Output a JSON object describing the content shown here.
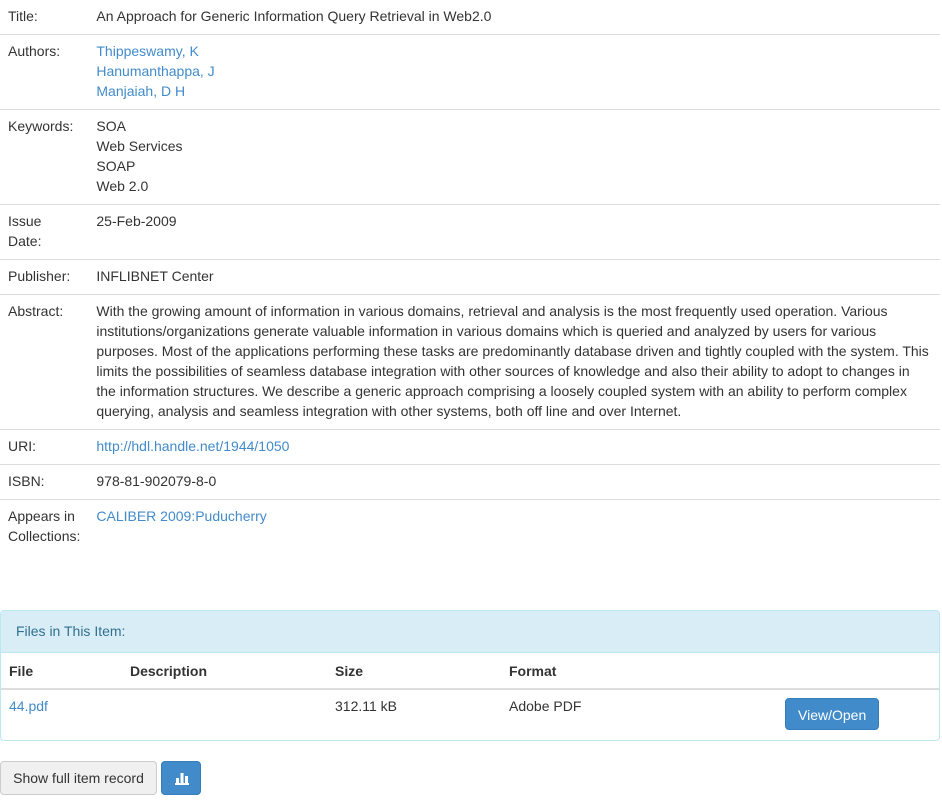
{
  "record": {
    "title": {
      "label": "Title:",
      "value": "An Approach for Generic Information Query Retrieval in Web2.0"
    },
    "authors": {
      "label": "Authors:",
      "values": [
        "Thippeswamy, K",
        "Hanumanthappa, J",
        "Manjaiah, D H"
      ]
    },
    "keywords": {
      "label": "Keywords:",
      "values": [
        "SOA",
        "Web Services",
        "SOAP",
        "Web 2.0"
      ]
    },
    "issue_date": {
      "label_line1": "Issue",
      "label_line2": "Date:",
      "value": "25-Feb-2009"
    },
    "publisher": {
      "label": "Publisher:",
      "value": "INFLIBNET Center"
    },
    "abstract": {
      "label": "Abstract:",
      "value": "With the growing amount of information in various domains, retrieval and analysis is the most frequently used operation. Various institutions/organizations generate valuable information in various domains which is queried and analyzed by users for various purposes. Most of the applications performing these tasks are predominantly database driven and tightly coupled with the system. This limits the possibilities of seamless database integration with other sources of knowledge and also their ability to adopt to changes in the information structures. We describe a generic approach comprising a loosely coupled system with an ability to perform complex querying, analysis and seamless integration with other systems, both off line and over Internet."
    },
    "uri": {
      "label": "URI:",
      "value": "http://hdl.handle.net/1944/1050"
    },
    "isbn": {
      "label": "ISBN:",
      "value": "978-81-902079-8-0"
    },
    "collections": {
      "label_line1": "Appears in",
      "label_line2": "Collections:",
      "value": "CALIBER 2009:Puducherry"
    }
  },
  "files_panel": {
    "heading": "Files in This Item:",
    "columns": {
      "file": "File",
      "description": "Description",
      "size": "Size",
      "format": "Format"
    },
    "rows": [
      {
        "file": "44.pdf",
        "description": "",
        "size": "312.11 kB",
        "format": "Adobe PDF",
        "action": "View/Open"
      }
    ]
  },
  "actions": {
    "show_full_record": "Show full item record",
    "stats_icon": "bar-chart-icon"
  },
  "colors": {
    "link": "#428bca",
    "primary_button": "#428bca",
    "panel_heading_bg": "#d9edf7",
    "panel_heading_text": "#31708f"
  }
}
